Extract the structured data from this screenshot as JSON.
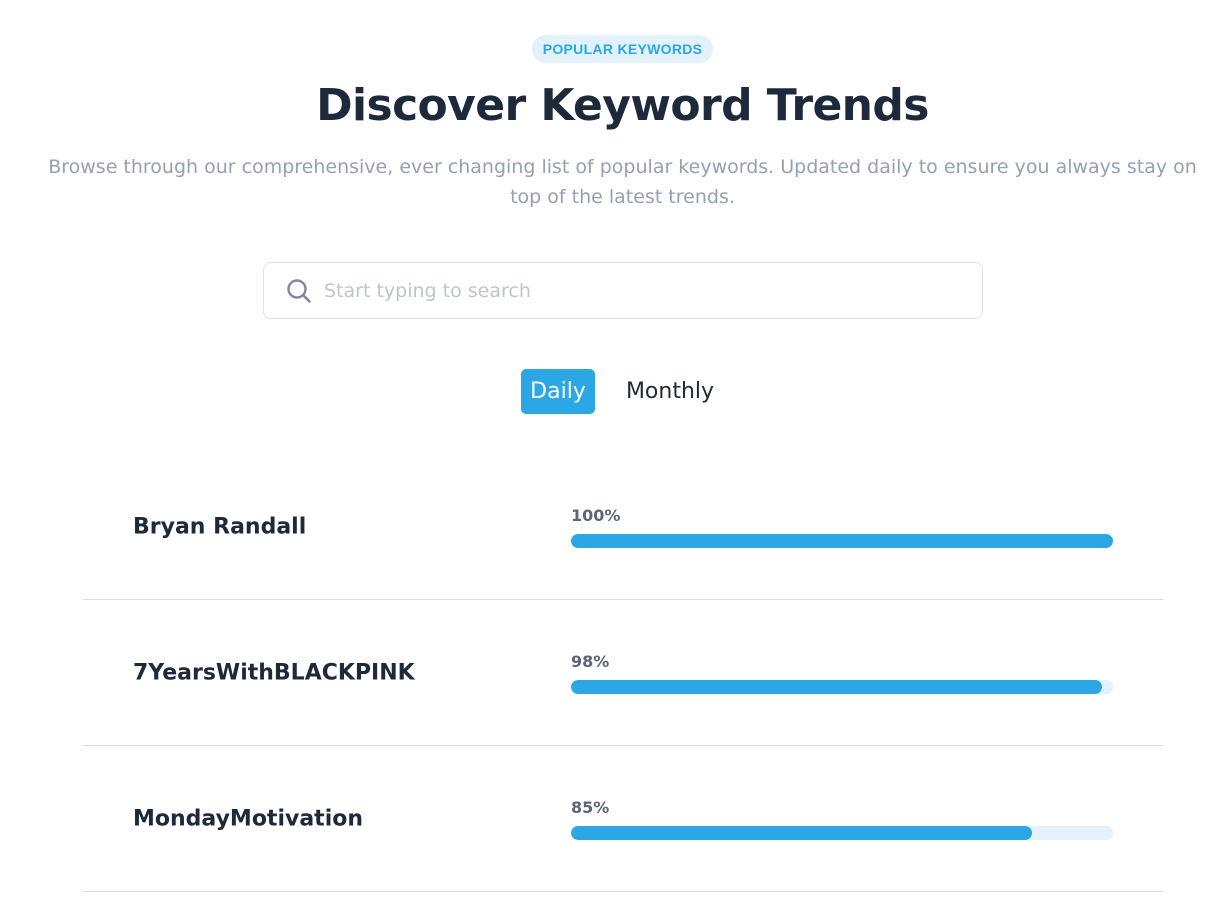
{
  "header": {
    "badge": "POPULAR KEYWORDS",
    "title": "Discover Keyword Trends",
    "subtitle": "Browse through our comprehensive, ever changing list of popular keywords. Updated daily to ensure you always stay on top of the latest trends."
  },
  "search": {
    "placeholder": "Start typing to search",
    "value": ""
  },
  "tabs": [
    {
      "label": "Daily",
      "active": true
    },
    {
      "label": "Monthly",
      "active": false
    }
  ],
  "keywords": [
    {
      "name": "Bryan Randall",
      "percent_label": "100%",
      "percent": 100
    },
    {
      "name": "7YearsWithBLACKPINK",
      "percent_label": "98%",
      "percent": 98
    },
    {
      "name": "MondayMotivation",
      "percent_label": "85%",
      "percent": 85
    }
  ],
  "colors": {
    "accent": "#2aa7e4",
    "track": "#e4f1fb",
    "badge_bg": "#e3f1fb",
    "heading": "#1e293b",
    "muted": "#94a0b3"
  }
}
